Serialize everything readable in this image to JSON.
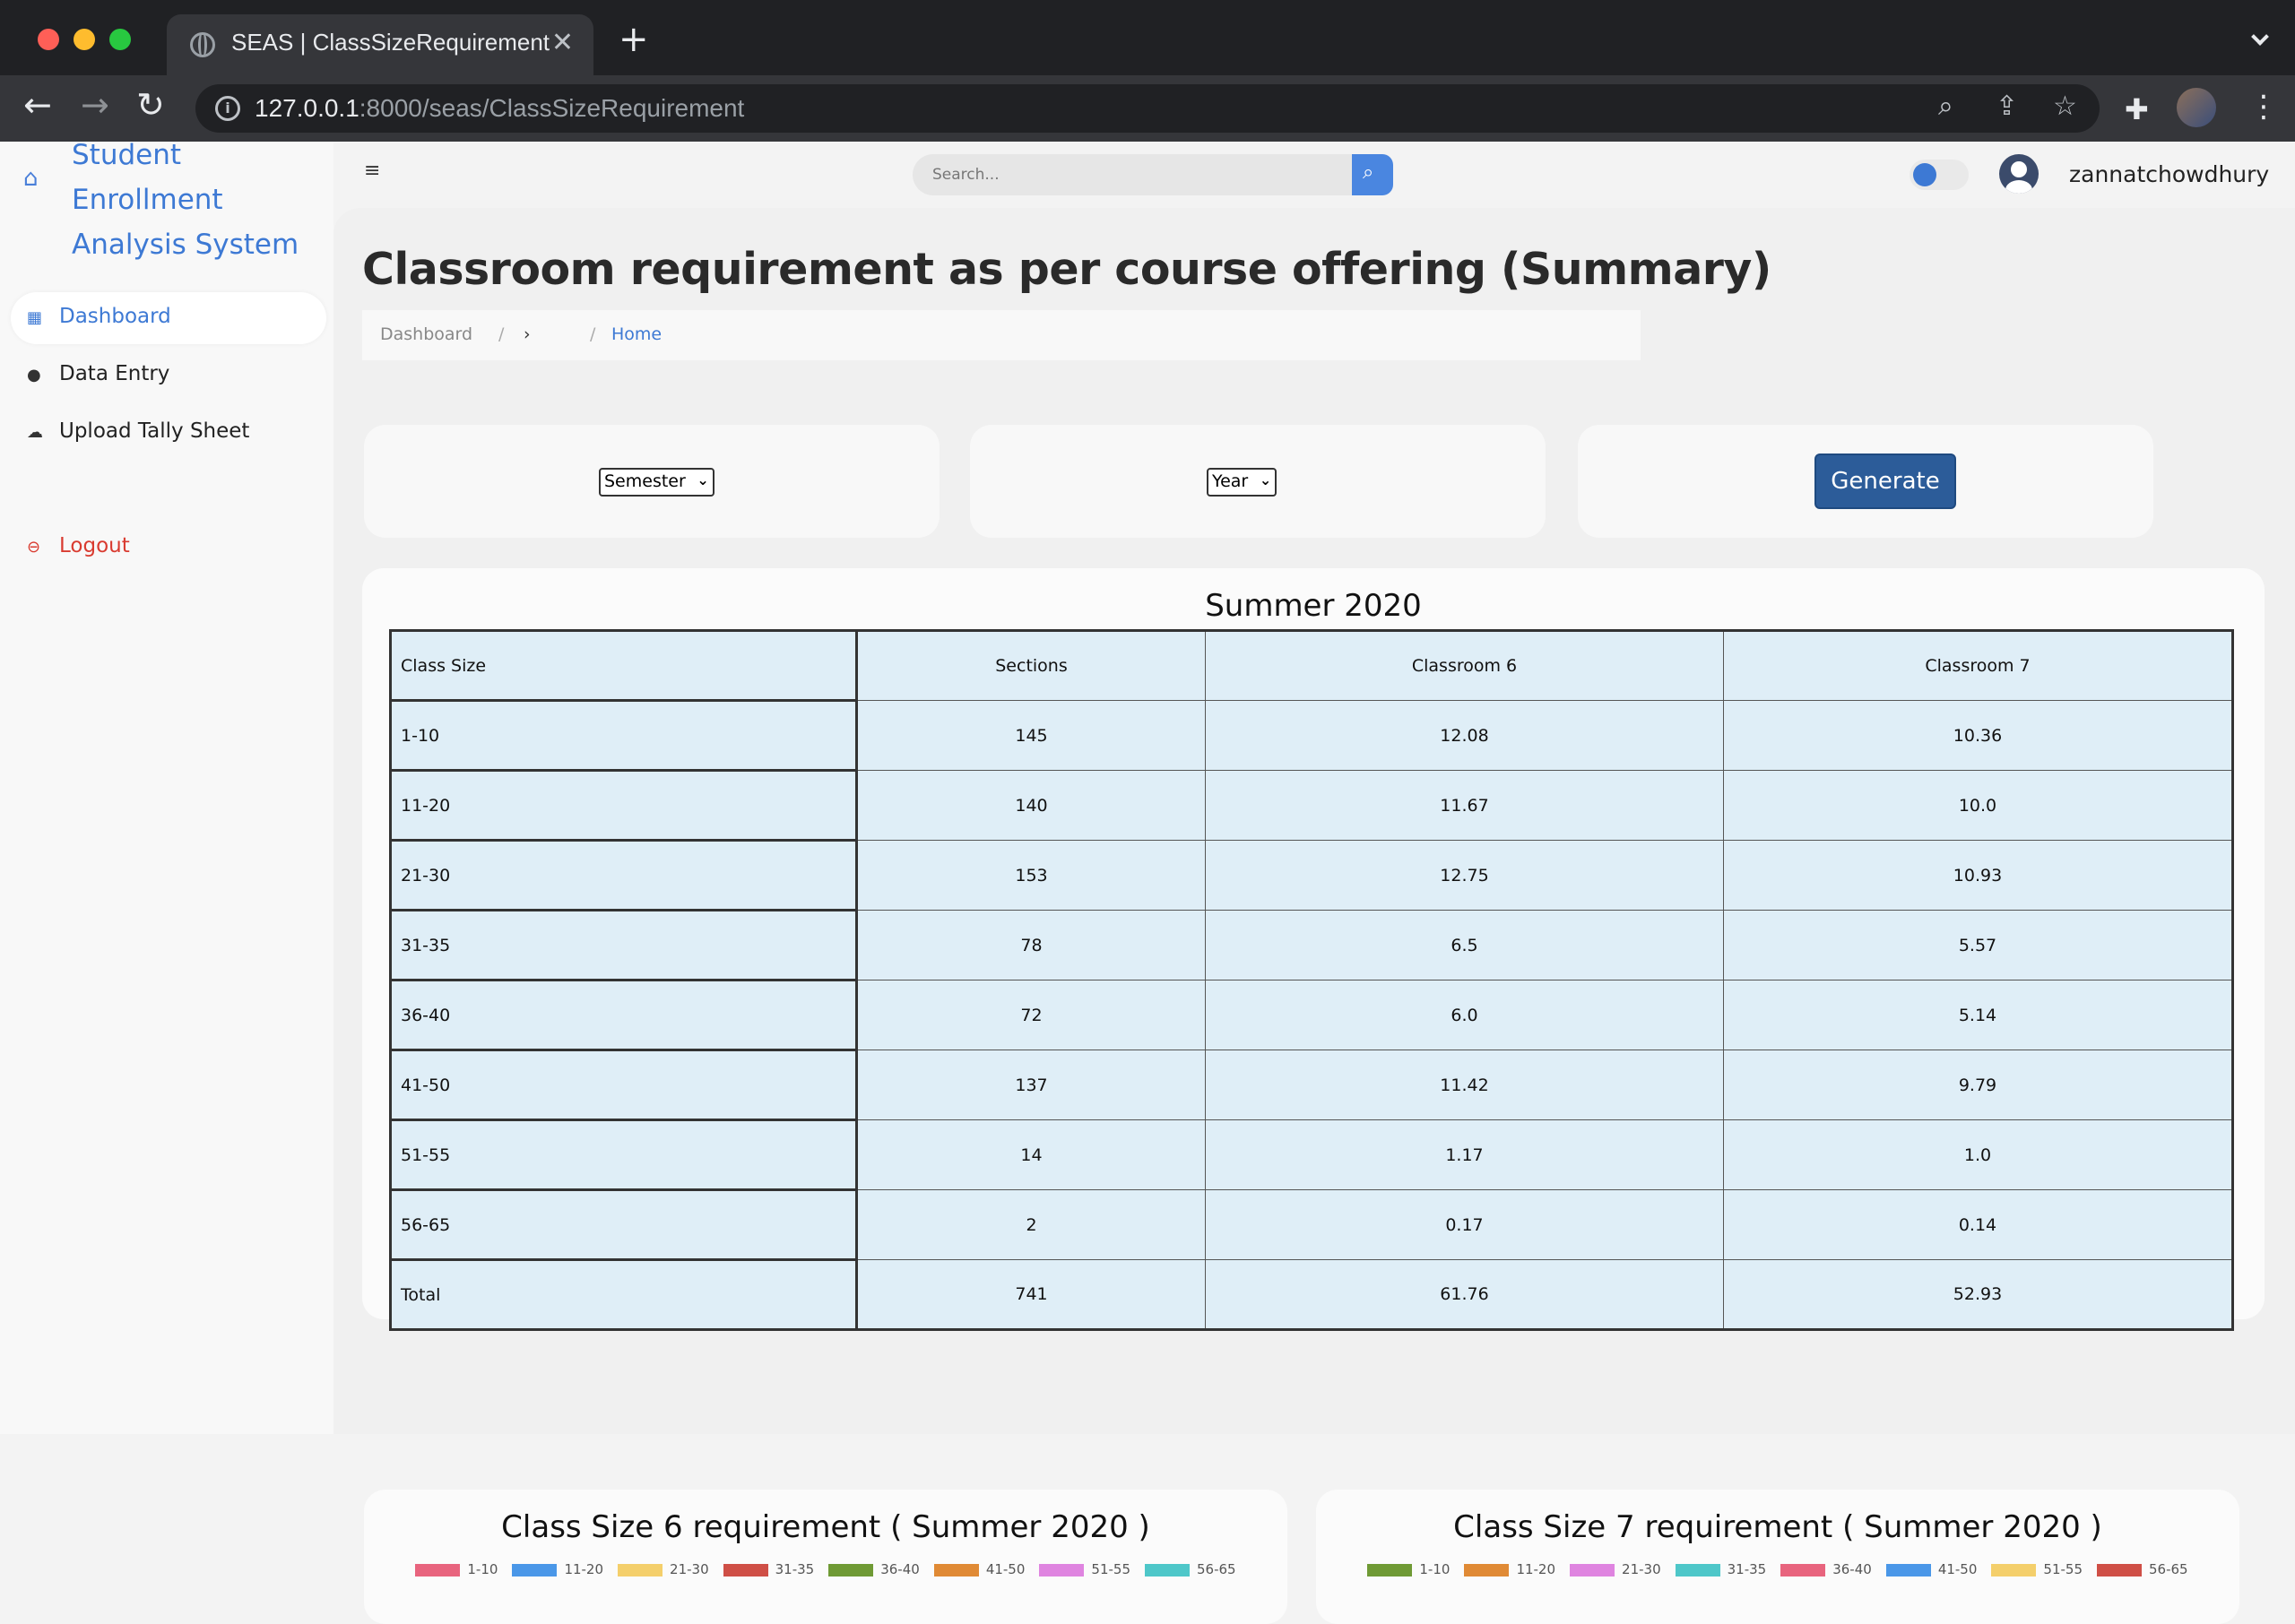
{
  "browser": {
    "tab_title": "SEAS | ClassSizeRequirement",
    "url_host": "127.0.0.1",
    "url_path": ":8000/seas/ClassSizeRequirement"
  },
  "sidebar": {
    "brand": "Student Enrollment Analysis System",
    "items": [
      {
        "label": "Dashboard",
        "icon": "grid-icon"
      },
      {
        "label": "Data Entry",
        "icon": "user-icon"
      },
      {
        "label": "Upload Tally Sheet",
        "icon": "cloud-upload-icon"
      },
      {
        "label": "Logout",
        "icon": "logout-icon"
      }
    ]
  },
  "topbar": {
    "search_placeholder": "Search...",
    "username": "zannatchowdhury"
  },
  "page": {
    "title": "Classroom requirement as per course offering (Summary)",
    "breadcrumb": {
      "dashboard": "Dashboard",
      "sep": "/",
      "arrow": "›",
      "home": "Home"
    }
  },
  "filters": {
    "semester": "Semester",
    "year": "Year",
    "generate": "Generate"
  },
  "table": {
    "title": "Summer 2020",
    "headers": [
      "Class Size",
      "Sections",
      "Classroom 6",
      "Classroom 7"
    ],
    "rows": [
      [
        "1-10",
        "145",
        "12.08",
        "10.36"
      ],
      [
        "11-20",
        "140",
        "11.67",
        "10.0"
      ],
      [
        "21-30",
        "153",
        "12.75",
        "10.93"
      ],
      [
        "31-35",
        "78",
        "6.5",
        "5.57"
      ],
      [
        "36-40",
        "72",
        "6.0",
        "5.14"
      ],
      [
        "41-50",
        "137",
        "11.42",
        "9.79"
      ],
      [
        "51-55",
        "14",
        "1.17",
        "1.0"
      ],
      [
        "56-65",
        "2",
        "0.17",
        "0.14"
      ],
      [
        "Total",
        "741",
        "61.76",
        "52.93"
      ]
    ]
  },
  "charts": [
    {
      "title": "Class Size 6 requirement ( Summer 2020 )",
      "legend": [
        {
          "label": "1-10",
          "color": "#e8647e"
        },
        {
          "label": "11-20",
          "color": "#4a97e8"
        },
        {
          "label": "21-30",
          "color": "#f4cf6b"
        },
        {
          "label": "31-35",
          "color": "#cf4f46"
        },
        {
          "label": "36-40",
          "color": "#6f9a35"
        },
        {
          "label": "41-50",
          "color": "#e08a35"
        },
        {
          "label": "51-55",
          "color": "#df84e0"
        },
        {
          "label": "56-65",
          "color": "#4ec7c9"
        }
      ]
    },
    {
      "title": "Class Size 7 requirement ( Summer 2020 )",
      "legend": [
        {
          "label": "1-10",
          "color": "#6f9a35"
        },
        {
          "label": "11-20",
          "color": "#e08a35"
        },
        {
          "label": "21-30",
          "color": "#df84e0"
        },
        {
          "label": "31-35",
          "color": "#4ec7c9"
        },
        {
          "label": "36-40",
          "color": "#e8647e"
        },
        {
          "label": "41-50",
          "color": "#4a97e8"
        },
        {
          "label": "51-55",
          "color": "#f4cf6b"
        },
        {
          "label": "56-65",
          "color": "#cf4f46"
        }
      ]
    }
  ]
}
